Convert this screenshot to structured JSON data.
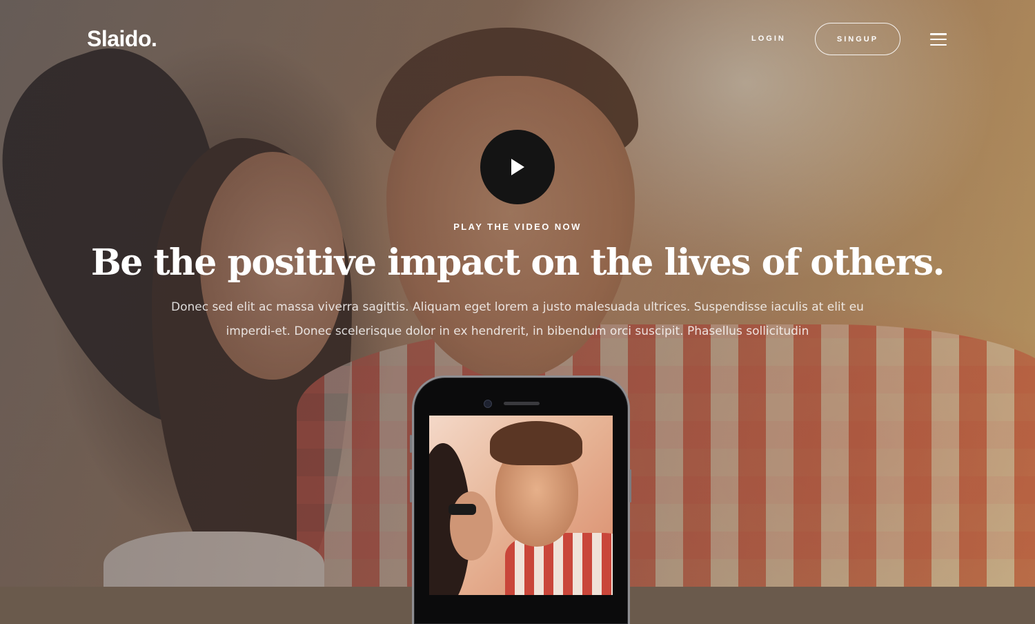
{
  "header": {
    "logo": "Slaido.",
    "login_label": "LOGIN",
    "signup_label": "SINGUP",
    "menu_icon": "hamburger-menu-icon"
  },
  "hero": {
    "play_icon": "play-icon",
    "eyebrow": "PLAY THE VIDEO NOW",
    "headline": "Be the positive impact on the lives of others.",
    "lead": "Donec sed elit ac massa viverra sagittis. Aliquam eget lorem a justo malesuada ultrices. Suspendisse iaculis at elit eu imperdi-et. Donec scelerisque dolor in ex hendrerit, in bibendum orci suscipit. Phasellus sollicitudin"
  },
  "colors": {
    "text": "#ffffff",
    "play_button": "#141414"
  }
}
